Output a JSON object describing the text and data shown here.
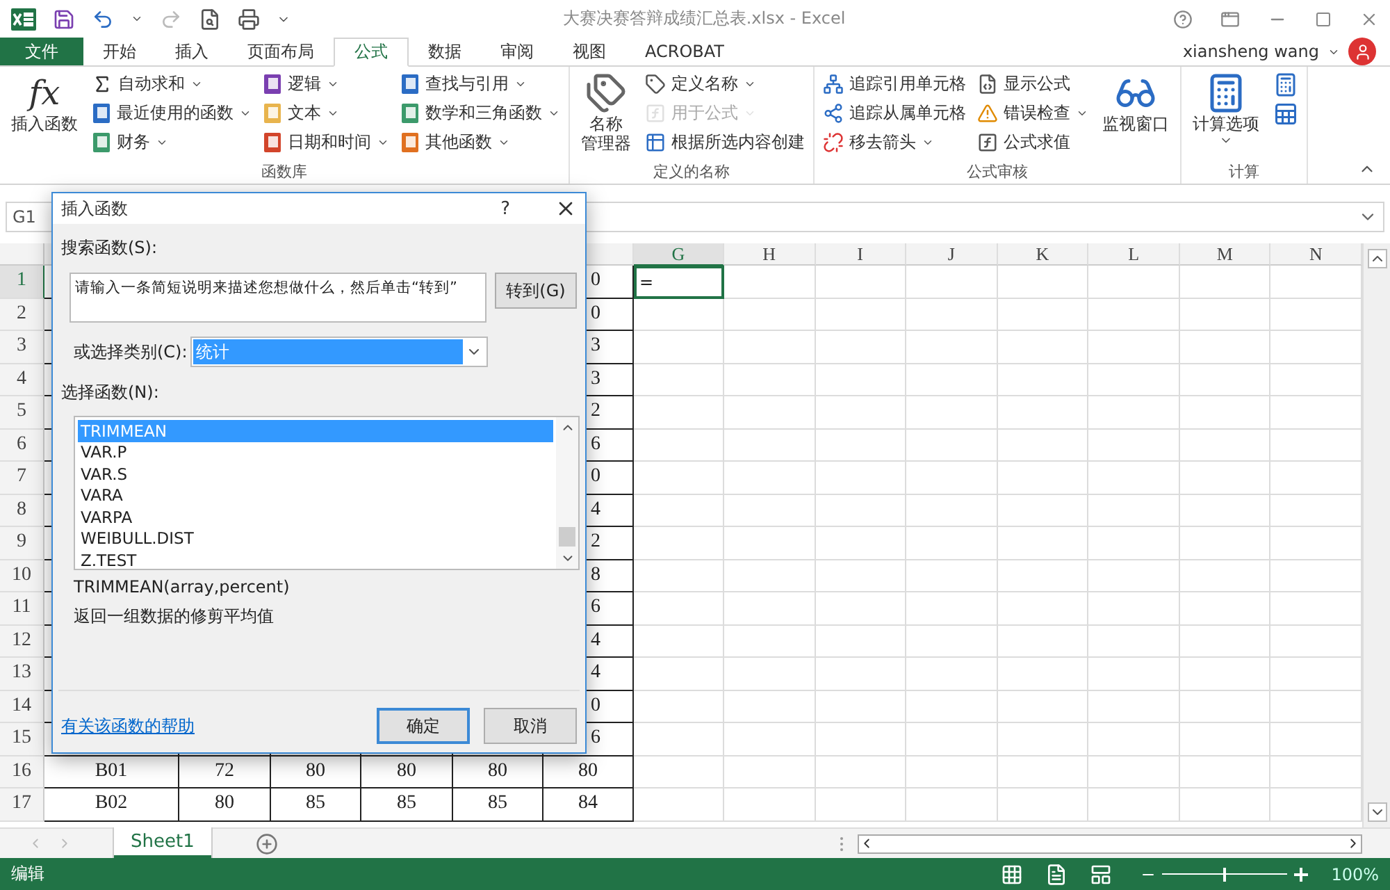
{
  "title_bar": {
    "title": "大赛决赛答辩成绩汇总表.xlsx - Excel"
  },
  "ribbon_tabs": [
    {
      "label": "文件",
      "kind": "file",
      "selected": false
    },
    {
      "label": "开始",
      "kind": "tab",
      "selected": false
    },
    {
      "label": "插入",
      "kind": "tab",
      "selected": false
    },
    {
      "label": "页面布局",
      "kind": "tab",
      "selected": false
    },
    {
      "label": "公式",
      "kind": "tab",
      "selected": true
    },
    {
      "label": "数据",
      "kind": "tab",
      "selected": false
    },
    {
      "label": "审阅",
      "kind": "tab",
      "selected": false
    },
    {
      "label": "视图",
      "kind": "tab",
      "selected": false
    },
    {
      "label": "ACROBAT",
      "kind": "tab",
      "selected": false
    }
  ],
  "account": {
    "user": "xiansheng wang"
  },
  "ribbon_groups": [
    {
      "label": "函数库",
      "sections": [
        {
          "kind": "large",
          "glyph": "fx",
          "lines": [
            "插入函数"
          ],
          "dropdown": false
        },
        {
          "kind": "stack",
          "items": [
            {
              "label": "自动求和",
              "dropdown": true,
              "disabled": false
            },
            {
              "label": "最近使用的函数",
              "dropdown": true,
              "disabled": false
            },
            {
              "label": "财务",
              "dropdown": true,
              "disabled": false
            }
          ]
        },
        {
          "kind": "stack",
          "items": [
            {
              "label": "逻辑",
              "dropdown": true,
              "disabled": false
            },
            {
              "label": "文本",
              "dropdown": true,
              "disabled": false
            },
            {
              "label": "日期和时间",
              "dropdown": true,
              "disabled": false
            }
          ]
        },
        {
          "kind": "stack",
          "items": [
            {
              "label": "查找与引用",
              "dropdown": true,
              "disabled": false
            },
            {
              "label": "数学和三角函数",
              "dropdown": true,
              "disabled": false
            },
            {
              "label": "其他函数",
              "dropdown": true,
              "disabled": false
            }
          ]
        }
      ]
    },
    {
      "label": "定义的名称",
      "sections": [
        {
          "kind": "large",
          "lines": [
            "名称",
            "管理器"
          ],
          "dropdown": false
        },
        {
          "kind": "stack",
          "items": [
            {
              "label": "定义名称",
              "dropdown": true,
              "disabled": false
            },
            {
              "label": "用于公式",
              "dropdown": true,
              "disabled": true
            },
            {
              "label": "根据所选内容创建",
              "dropdown": false,
              "disabled": false
            }
          ]
        }
      ]
    },
    {
      "label": "公式审核",
      "sections": [
        {
          "kind": "stack",
          "items": [
            {
              "label": "追踪引用单元格",
              "dropdown": false,
              "disabled": false
            },
            {
              "label": "追踪从属单元格",
              "dropdown": false,
              "disabled": false
            },
            {
              "label": "移去箭头",
              "dropdown": true,
              "disabled": false
            }
          ]
        },
        {
          "kind": "stack",
          "items": [
            {
              "label": "显示公式",
              "dropdown": false,
              "disabled": false
            },
            {
              "label": "错误检查",
              "dropdown": true,
              "disabled": false
            },
            {
              "label": "公式求值",
              "dropdown": false,
              "disabled": false
            }
          ]
        },
        {
          "kind": "large",
          "lines": [
            "监视窗口"
          ],
          "dropdown": false
        }
      ]
    },
    {
      "label": "计算",
      "sections": [
        {
          "kind": "large",
          "lines": [
            "计算选项"
          ],
          "dropdown": true
        },
        {
          "kind": "stack",
          "items": [
            {
              "dropdown": false,
              "disabled": false
            },
            {
              "dropdown": false,
              "disabled": false
            }
          ]
        }
      ]
    }
  ],
  "formula_bar": {
    "name_box": "G1"
  },
  "sheet": {
    "column_headers": [
      {
        "label": "G",
        "selected": true
      },
      {
        "label": "H",
        "selected": false
      },
      {
        "label": "I",
        "selected": false
      },
      {
        "label": "J",
        "selected": false
      },
      {
        "label": "K",
        "selected": false
      },
      {
        "label": "L",
        "selected": false
      },
      {
        "label": "M",
        "selected": false
      },
      {
        "label": "N",
        "selected": false
      }
    ],
    "active_cell_text": "=",
    "rows": [
      {
        "header": "1",
        "selected": true,
        "f_tail": "0"
      },
      {
        "header": "2",
        "selected": false,
        "f_tail": "0"
      },
      {
        "header": "3",
        "selected": false,
        "f_tail": "3"
      },
      {
        "header": "4",
        "selected": false,
        "f_tail": "3"
      },
      {
        "header": "5",
        "selected": false,
        "f_tail": "2"
      },
      {
        "header": "6",
        "selected": false,
        "f_tail": "6"
      },
      {
        "header": "7",
        "selected": false,
        "f_tail": "0"
      },
      {
        "header": "8",
        "selected": false,
        "f_tail": "4"
      },
      {
        "header": "9",
        "selected": false,
        "f_tail": "2"
      },
      {
        "header": "10",
        "selected": false,
        "f_tail": "8"
      },
      {
        "header": "11",
        "selected": false,
        "f_tail": "6"
      },
      {
        "header": "12",
        "selected": false,
        "f_tail": "4"
      },
      {
        "header": "13",
        "selected": false,
        "f_tail": "4"
      },
      {
        "header": "14",
        "selected": false,
        "f_tail": "0"
      },
      {
        "header": "15",
        "selected": false,
        "f_tail": "6"
      },
      {
        "header": "16",
        "selected": false,
        "cells": [
          "B01",
          "72",
          "80",
          "80",
          "80",
          "80"
        ]
      },
      {
        "header": "17",
        "selected": false,
        "cells": [
          "B02",
          "80",
          "85",
          "85",
          "85",
          "84"
        ]
      }
    ]
  },
  "dialog": {
    "title": "插入函数",
    "help": "?",
    "search_label": "搜索函数(S):",
    "search_value": "请输入一条简短说明来描述您想做什么，然后单击“转到”",
    "go_button": "转到(G)",
    "category_label": "或选择类别(C):",
    "category_value": "统计",
    "list_label": "选择函数(N):",
    "function_list": [
      {
        "label": "TRIMMEAN",
        "selected": true
      },
      {
        "label": "VAR.P",
        "selected": false
      },
      {
        "label": "VAR.S",
        "selected": false
      },
      {
        "label": "VARA",
        "selected": false
      },
      {
        "label": "VARPA",
        "selected": false
      },
      {
        "label": "WEIBULL.DIST",
        "selected": false
      },
      {
        "label": "Z.TEST",
        "selected": false
      }
    ],
    "syntax": "TRIMMEAN(array,percent)",
    "description": "返回一组数据的修剪平均值",
    "help_link": "有关该函数的帮助",
    "buttons": [
      {
        "label": "确定",
        "default": true
      },
      {
        "label": "取消",
        "default": false
      }
    ]
  },
  "sheet_tabs": [
    {
      "label": "Sheet1",
      "selected": true
    }
  ],
  "status_bar": {
    "mode": "编辑",
    "zoom": {
      "level": 0.5
    },
    "zoom_text": "100%"
  }
}
